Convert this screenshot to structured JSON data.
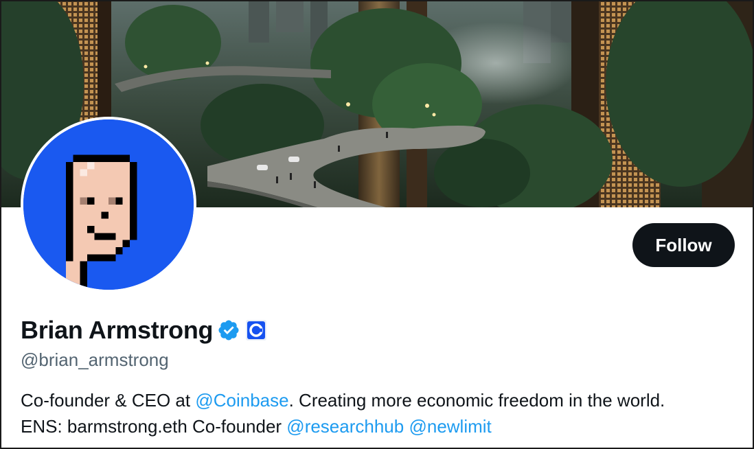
{
  "profile": {
    "name": "Brian Armstrong",
    "handle": "@brian_armstrong",
    "verified_icon": "verified-badge-icon",
    "affiliate_icon": "coinbase-logo-icon",
    "follow_label": "Follow"
  },
  "bio": {
    "line1_prefix": "Co-founder & CEO at ",
    "line1_mention": "@Coinbase",
    "line1_suffix": ". Creating more economic freedom in the world.",
    "line2_prefix": "ENS: barmstrong.eth Co-founder ",
    "line2_mention1": "@researchhub",
    "line2_mention2": "@newlimit"
  },
  "colors": {
    "accent": "#1d9bf0",
    "follow_bg": "#0f1419",
    "avatar_bg": "#1a59f0",
    "handle_text": "#536471"
  }
}
